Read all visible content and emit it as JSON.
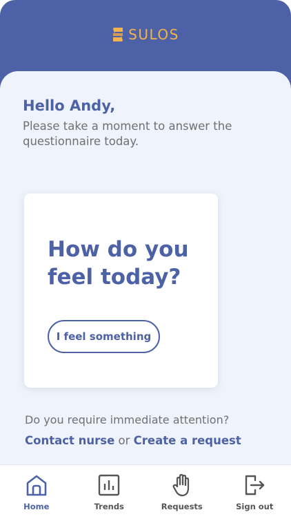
{
  "header": {
    "brand": "SULOS",
    "logo_icon": "sulos-logo-mark",
    "brand_color": "#f2b24e",
    "background_color": "#4d62a6"
  },
  "greeting": {
    "title": "Hello Andy,",
    "subtitle": "Please take a moment to answer the questionnaire today."
  },
  "card": {
    "title": "How do you feel today?",
    "button_label": "I feel something"
  },
  "attention": {
    "question": "Do you require immediate attention?",
    "contact_label": "Contact nurse",
    "separator": "or",
    "request_label": "Create a request"
  },
  "nav": {
    "active": "Home",
    "items": [
      {
        "label": "Home",
        "icon": "home-icon"
      },
      {
        "label": "Trends",
        "icon": "trends-icon"
      },
      {
        "label": "Requests",
        "icon": "hand-icon"
      },
      {
        "label": "Sign out",
        "icon": "sign-out-icon"
      }
    ]
  },
  "colors": {
    "accent": "#4d62a6",
    "content_background": "#eff3fc",
    "muted_text": "#707070"
  }
}
